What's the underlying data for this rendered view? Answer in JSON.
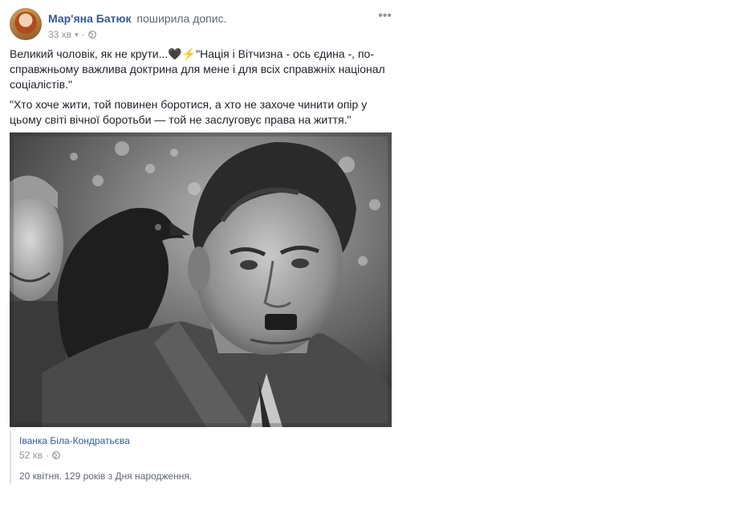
{
  "post": {
    "author": "Мар'яна Батюк",
    "action": "поширила допис.",
    "time": "33 хв",
    "caret": "▾",
    "privacy_icon": "globe-icon",
    "more_label": "•••",
    "body_paragraph_1_part_1": "Великий чоловік, як не крути...",
    "heart": "🖤",
    "bolt": "⚡",
    "body_paragraph_1_part_2": "\"Нація і Вітчизна - ось єдина -, по-справжньому важлива доктрина для мене і для всіх справжніх націонал соціалістів.\"",
    "body_paragraph_2": "\"Хто хоче жити, той повинен боротися, а хто не захоче чинити опір у цьому світі вічної боротьби — той не заслуговує права на життя.\""
  },
  "shared": {
    "author": "Іванка Біла-Кондратьєва",
    "time": "52 хв",
    "privacy_icon": "globe-icon",
    "text": "20 квітня. 129 років з Дня народження."
  },
  "colors": {
    "link": "#365899",
    "meta": "#90949c",
    "text": "#1d2129"
  }
}
